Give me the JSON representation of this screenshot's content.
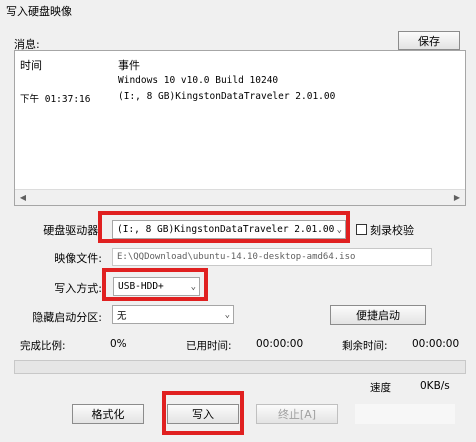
{
  "window": {
    "title": "写入硬盘映像"
  },
  "messages": {
    "label": "消息:",
    "save_label": "保存",
    "headers": {
      "time": "时间",
      "event": "事件"
    },
    "rows": [
      {
        "time": "",
        "event": "Windows 10 v10.0 Build 10240"
      },
      {
        "time": "下午 01:37:16",
        "event": "(I:, 8 GB)KingstonDataTraveler 2.01.00"
      }
    ]
  },
  "form": {
    "drive_label": "硬盘驱动器:",
    "drive_value": "(I:, 8 GB)KingstonDataTraveler 2.01.00",
    "verify_label": "刻录校验",
    "image_label": "映像文件:",
    "image_value": "E:\\QQDownload\\ubuntu-14.10-desktop-amd64.iso",
    "write_method_label": "写入方式:",
    "write_method_value": "USB-HDD+",
    "hidden_partition_label": "隐藏启动分区:",
    "hidden_partition_value": "无",
    "boot_button_label": "便捷启动"
  },
  "status": {
    "completion_label": "完成比例:",
    "completion_value": "0%",
    "elapsed_label": "已用时间:",
    "elapsed_value": "00:00:00",
    "remaining_label": "剩余时间:",
    "remaining_value": "00:00:00",
    "progress_fraction": 0,
    "speed_label": "速度",
    "speed_value": "0KB/s"
  },
  "buttons": {
    "format": "格式化",
    "write": "写入",
    "stop": "终止[A]"
  },
  "colors": {
    "highlight": "#e02020"
  }
}
